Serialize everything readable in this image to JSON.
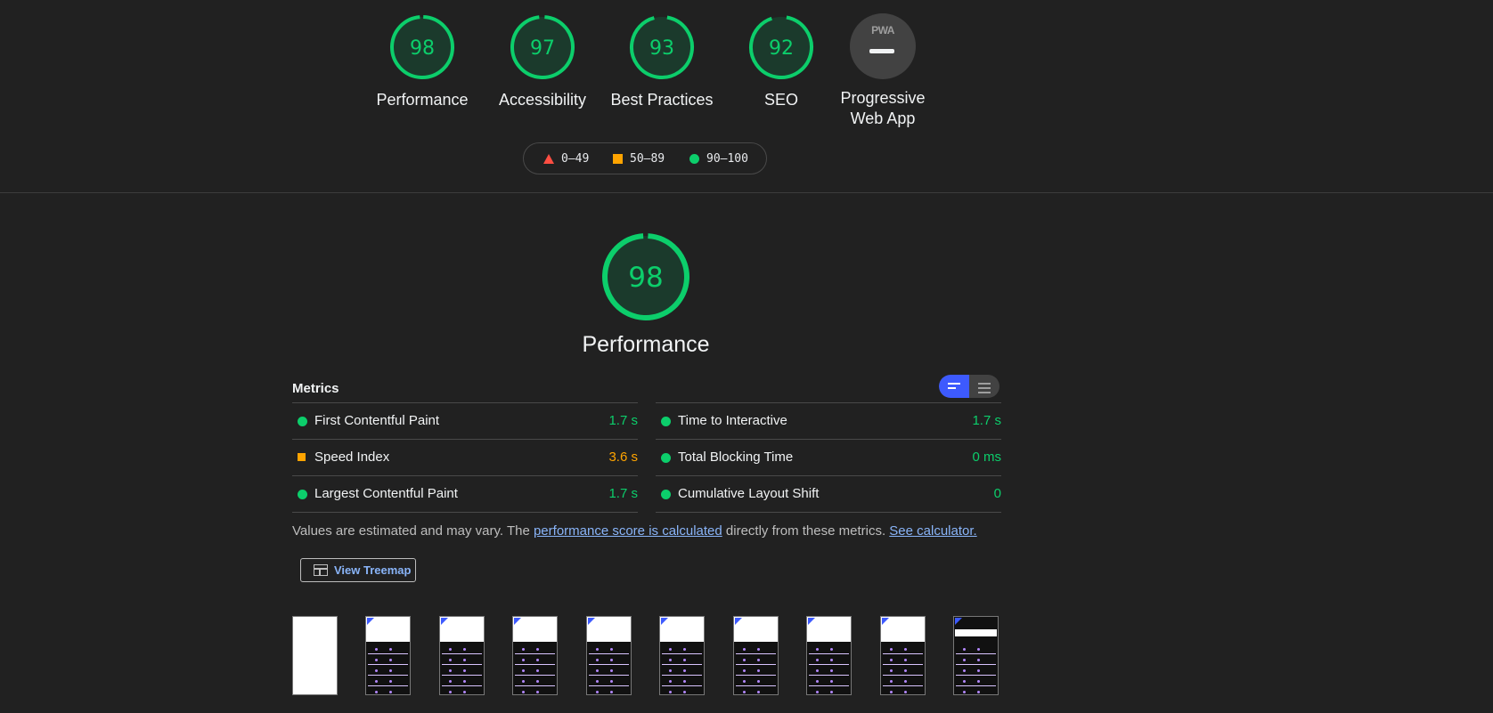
{
  "categories": [
    {
      "score": "98",
      "label": "Performance"
    },
    {
      "score": "97",
      "label": "Accessibility"
    },
    {
      "score": "93",
      "label": "Best Practices"
    },
    {
      "score": "92",
      "label": "SEO"
    }
  ],
  "pwa": {
    "badge": "PWA",
    "label_line1": "Progressive",
    "label_line2": "Web App"
  },
  "legend": {
    "fail": "0–49",
    "average": "50–89",
    "pass": "90–100"
  },
  "performance": {
    "score": "98",
    "title": "Performance"
  },
  "metrics": {
    "title": "Metrics",
    "left": [
      {
        "name": "First Contentful Paint",
        "value": "1.7 s",
        "rating": "pass"
      },
      {
        "name": "Speed Index",
        "value": "3.6 s",
        "rating": "average"
      },
      {
        "name": "Largest Contentful Paint",
        "value": "1.7 s",
        "rating": "pass"
      }
    ],
    "right": [
      {
        "name": "Time to Interactive",
        "value": "1.7 s",
        "rating": "pass"
      },
      {
        "name": "Total Blocking Time",
        "value": "0 ms",
        "rating": "pass"
      },
      {
        "name": "Cumulative Layout Shift",
        "value": "0",
        "rating": "pass"
      }
    ]
  },
  "note": {
    "prefix": "Values are estimated and may vary. The ",
    "link1": "performance score is calculated",
    "middle": " directly from these metrics. ",
    "link2": "See calculator."
  },
  "treemap": {
    "label": "View Treemap",
    "icon": "treemap-icon"
  },
  "colors": {
    "pass": "#0cce6b",
    "average": "#ffa400",
    "fail": "#ff4e42",
    "accent": "#3d5afe"
  }
}
